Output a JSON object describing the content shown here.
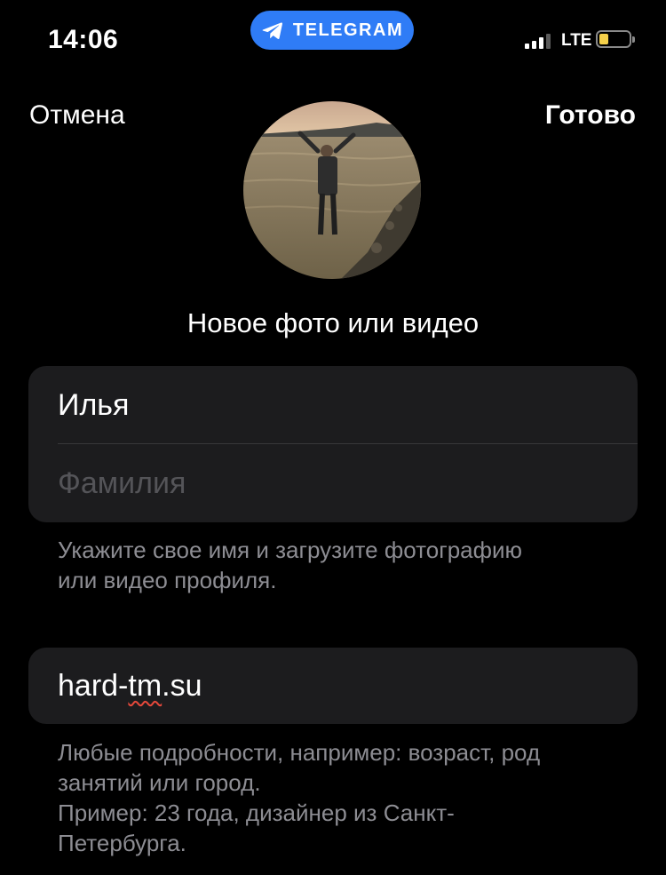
{
  "status": {
    "time": "14:06",
    "app_pill": "TELEGRAM",
    "network": "LTE",
    "battery_level": 0.3,
    "colors": {
      "pill": "#2f7cf6",
      "battery": "#f6d14a"
    }
  },
  "nav": {
    "cancel": "Отмена",
    "done": "Готово"
  },
  "profile": {
    "photo_icon": "profile-photo",
    "new_photo": "Новое фото или видео"
  },
  "name_section": {
    "first_name": "Илья",
    "last_name_placeholder": "Фамилия",
    "hint_line1": "Укажите свое имя и загрузите фотографию",
    "hint_line2": "или видео профиля."
  },
  "bio_section": {
    "value_part1": "hard-",
    "value_misspelled": "tm",
    "value_part2": ".su",
    "hint_line1": "Любые подробности, например: возраст, род",
    "hint_line2": "занятий или город.",
    "hint_line3": "Пример: 23 года, дизайнер из Санкт-",
    "hint_line4": "Петербурга."
  },
  "colors": {
    "background": "#000000",
    "group": "#1c1c1e",
    "hint": "#8d8d93",
    "spellcheck": "#e5483b"
  }
}
